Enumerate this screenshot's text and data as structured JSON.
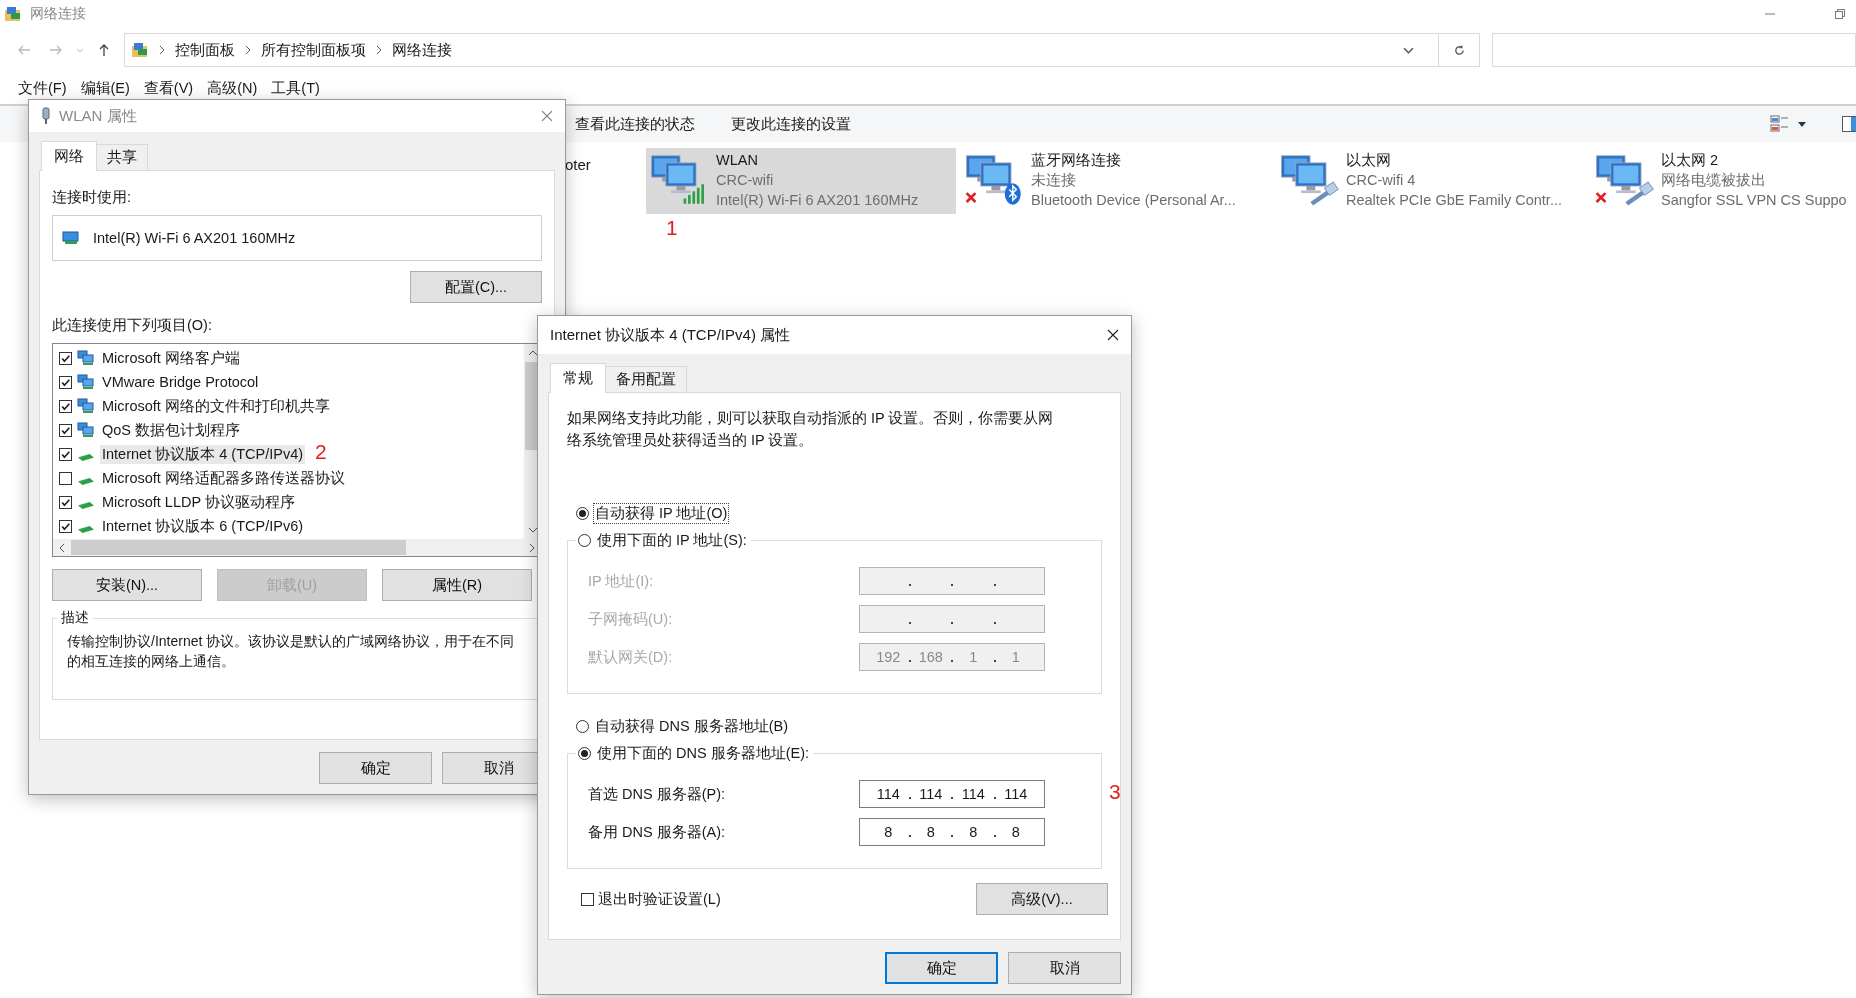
{
  "explorer": {
    "title": "网络连接",
    "breadcrumb": [
      "控制面板",
      "所有控制面板项",
      "网络连接"
    ],
    "menu": [
      "文件(F)",
      "编辑(E)",
      "查看(V)",
      "高级(N)",
      "工具(T)"
    ],
    "commands": [
      "查看此连接的状态",
      "更改此连接的设置"
    ],
    "partial_item": "oter",
    "connections": [
      {
        "name": "WLAN",
        "status": "CRC-wifi",
        "device": "Intel(R) Wi-Fi 6 AX201 160MHz",
        "kind": "wifi",
        "disconnected": false,
        "selected": true,
        "annotation": "1"
      },
      {
        "name": "蓝牙网络连接",
        "status": "未连接",
        "device": "Bluetooth Device (Personal Ar...",
        "kind": "bluetooth",
        "disconnected": true,
        "selected": false
      },
      {
        "name": "以太网",
        "status": "CRC-wifi 4",
        "device": "Realtek PCIe GbE Family Contr...",
        "kind": "ethernet",
        "disconnected": false,
        "selected": false
      },
      {
        "name": "以太网 2",
        "status": "网络电缆被拔出",
        "device": "Sangfor SSL VPN CS Suppo",
        "kind": "ethernet",
        "disconnected": true,
        "selected": false
      }
    ]
  },
  "wlan_dialog": {
    "title": "WLAN 属性",
    "tabs": [
      {
        "label": "网络",
        "selected": true
      },
      {
        "label": "共享",
        "selected": false
      }
    ],
    "adapter_label": "连接时使用:",
    "adapter": "Intel(R) Wi-Fi 6 AX201 160MHz",
    "configure_button": "配置(C)...",
    "items_label": "此连接使用下列项目(O):",
    "items": [
      {
        "label": "Microsoft 网络客户端",
        "checked": true,
        "selected": false,
        "kind": "client"
      },
      {
        "label": "VMware Bridge Protocol",
        "checked": true,
        "selected": false,
        "kind": "client"
      },
      {
        "label": "Microsoft 网络的文件和打印机共享",
        "checked": true,
        "selected": false,
        "kind": "client"
      },
      {
        "label": "QoS 数据包计划程序",
        "checked": true,
        "selected": false,
        "kind": "client"
      },
      {
        "label": "Internet 协议版本 4 (TCP/IPv4)",
        "checked": true,
        "selected": true,
        "kind": "protocol",
        "annotation": "2"
      },
      {
        "label": "Microsoft 网络适配器多路传送器协议",
        "checked": false,
        "selected": false,
        "kind": "protocol"
      },
      {
        "label": "Microsoft LLDP 协议驱动程序",
        "checked": true,
        "selected": false,
        "kind": "protocol"
      },
      {
        "label": "Internet 协议版本 6 (TCP/IPv6)",
        "checked": true,
        "selected": false,
        "kind": "protocol"
      }
    ],
    "buttons": [
      {
        "label": "安装(N)...",
        "disabled": false
      },
      {
        "label": "卸载(U)",
        "disabled": true
      },
      {
        "label": "属性(R)",
        "disabled": false
      }
    ],
    "description_title": "描述",
    "description": "传输控制协议/Internet 协议。该协议是默认的广域网络协议，用于在不同的相互连接的网络上通信。",
    "footer_buttons": [
      "确定",
      "取消"
    ]
  },
  "ipv4_dialog": {
    "title": "Internet 协议版本 4 (TCP/IPv4) 属性",
    "tabs": [
      {
        "label": "常规",
        "selected": true
      },
      {
        "label": "备用配置",
        "selected": false
      }
    ],
    "intro": "如果网络支持此功能，则可以获取自动指派的 IP 设置。否则，你需要从网络系统管理员处获得适当的 IP 设置。",
    "ip_options": [
      {
        "label": "自动获得 IP 地址(O)",
        "selected": true,
        "focused": true
      },
      {
        "label": "使用下面的 IP 地址(S):",
        "selected": false,
        "focused": false
      }
    ],
    "ip_fields": [
      {
        "label": "IP 地址(I):",
        "disabled": true
      },
      {
        "label": "子网掩码(U):",
        "disabled": true
      },
      {
        "label": "默认网关(D):",
        "disabled": true,
        "octets": [
          "192",
          "168",
          "1",
          "1"
        ]
      }
    ],
    "dns_options": [
      {
        "label": "自动获得 DNS 服务器地址(B)",
        "selected": false,
        "focused": false
      },
      {
        "label": "使用下面的 DNS 服务器地址(E):",
        "selected": true,
        "focused": false
      }
    ],
    "dns_fields": [
      {
        "label": "首选 DNS 服务器(P):",
        "disabled": false,
        "octets": [
          "114",
          "114",
          "114",
          "114"
        ],
        "annotation": "3"
      },
      {
        "label": "备用 DNS 服务器(A):",
        "disabled": false,
        "octets": [
          "8",
          "8",
          "8",
          "8"
        ]
      }
    ],
    "validate_on_exit": {
      "label": "退出时验证设置(L)",
      "checked": false
    },
    "advanced_button": "高级(V)...",
    "footer_buttons": [
      {
        "label": "确定",
        "default": true
      },
      {
        "label": "取消",
        "default": false
      }
    ]
  }
}
